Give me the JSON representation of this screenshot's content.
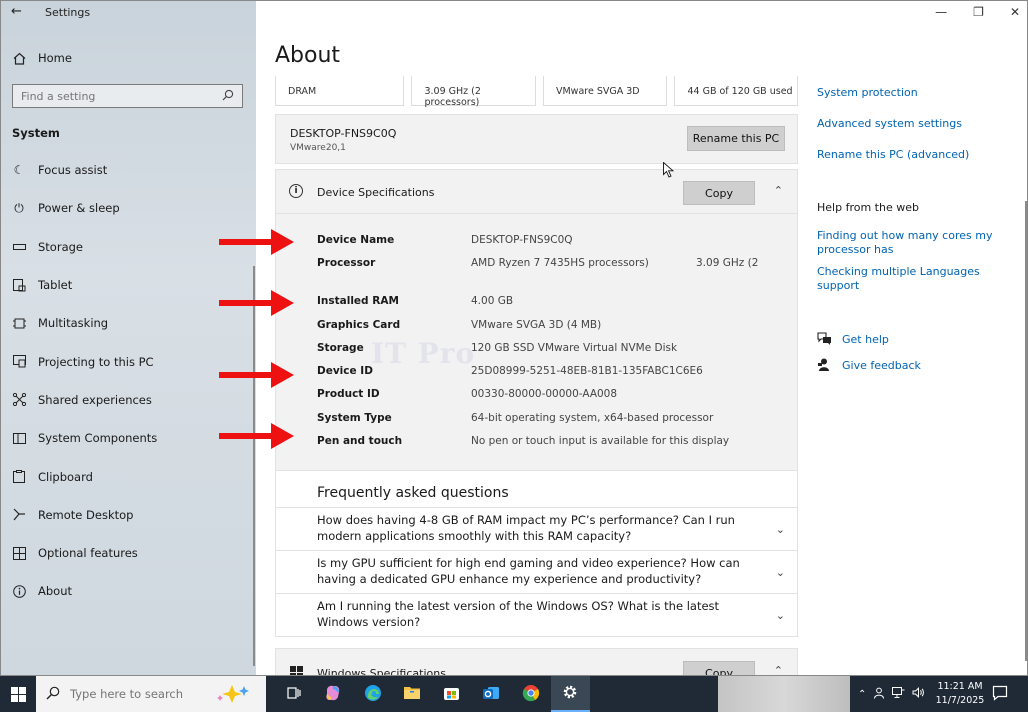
{
  "window": {
    "app_title": "Settings",
    "controls": {
      "minimize": "—",
      "restore": "❐",
      "close": "✕"
    }
  },
  "sidebar": {
    "home_label": "Home",
    "search_placeholder": "Find a setting",
    "section_label": "System",
    "items": [
      {
        "label": "Focus assist",
        "icon": "moon-icon"
      },
      {
        "label": "Power & sleep",
        "icon": "power-icon"
      },
      {
        "label": "Storage",
        "icon": "storage-icon"
      },
      {
        "label": "Tablet",
        "icon": "tablet-icon"
      },
      {
        "label": "Multitasking",
        "icon": "multitasking-icon"
      },
      {
        "label": "Projecting to this PC",
        "icon": "projecting-icon"
      },
      {
        "label": "Shared experiences",
        "icon": "shared-icon"
      },
      {
        "label": "System Components",
        "icon": "components-icon"
      },
      {
        "label": "Clipboard",
        "icon": "clipboard-icon"
      },
      {
        "label": "Remote Desktop",
        "icon": "remote-icon"
      },
      {
        "label": "Optional features",
        "icon": "features-icon"
      },
      {
        "label": "About",
        "icon": "info-icon"
      }
    ]
  },
  "main": {
    "page_title": "About",
    "tiles": [
      "DRAM",
      "3.09 GHz (2 processors)",
      "VMware SVGA 3D",
      "44 GB of 120 GB used"
    ],
    "pc": {
      "name": "DESKTOP-FNS9C0Q",
      "model": "VMware20,1",
      "rename_label": "Rename this PC"
    },
    "device_specs": {
      "title": "Device Specifications",
      "copy_label": "Copy",
      "rows": [
        {
          "key": "Device Name",
          "value": "DESKTOP-FNS9C0Q",
          "value2": ""
        },
        {
          "key": "Processor",
          "value": "AMD Ryzen 7 7435HS processors)",
          "value2": "3.09 GHz (2"
        },
        {
          "key": "Installed RAM",
          "value": "4.00 GB",
          "value2": ""
        },
        {
          "key": "Graphics Card",
          "value": "VMware SVGA 3D (4 MB)",
          "value2": ""
        },
        {
          "key": "Storage",
          "value": "120 GB SSD VMware Virtual NVMe Disk",
          "value2": ""
        },
        {
          "key": "Device ID",
          "value": "25D08999-5251-48EB-81B1-135FABC1C6E6",
          "value2": ""
        },
        {
          "key": "Product ID",
          "value": "00330-80000-00000-AA008",
          "value2": ""
        },
        {
          "key": "System Type",
          "value": "64-bit operating system, x64-based processor",
          "value2": ""
        },
        {
          "key": "Pen and touch",
          "value": "No pen or touch input is available for this display",
          "value2": ""
        }
      ]
    },
    "faq": {
      "title": "Frequently asked questions",
      "items": [
        "How does having 4-8 GB of RAM impact my PC’s performance? Can I run modern applications smoothly with this RAM capacity?",
        "Is my GPU sufficient for high end gaming and video experience? How can having a dedicated GPU enhance my experience and productivity?",
        "Am I running the latest version of the Windows OS? What is the latest Windows version?"
      ]
    },
    "windows_specs": {
      "title": "Windows Specifications",
      "copy_label": "Copy"
    },
    "watermark": "IT Pro"
  },
  "right": {
    "links": [
      "System protection",
      "Advanced system settings",
      "Rename this PC (advanced)"
    ],
    "help_heading": "Help from the web",
    "web_links": [
      "Finding out how many cores my processor has",
      "Checking multiple Languages support"
    ],
    "get_help": "Get help",
    "give_feedback": "Give feedback"
  },
  "taskbar": {
    "search_placeholder": "Type here to search",
    "time": "11:21 AM",
    "date": "11/7/2025"
  },
  "colors": {
    "link": "#0063b1",
    "arrow": "#ee1111",
    "taskbar": "#1f2a36"
  }
}
